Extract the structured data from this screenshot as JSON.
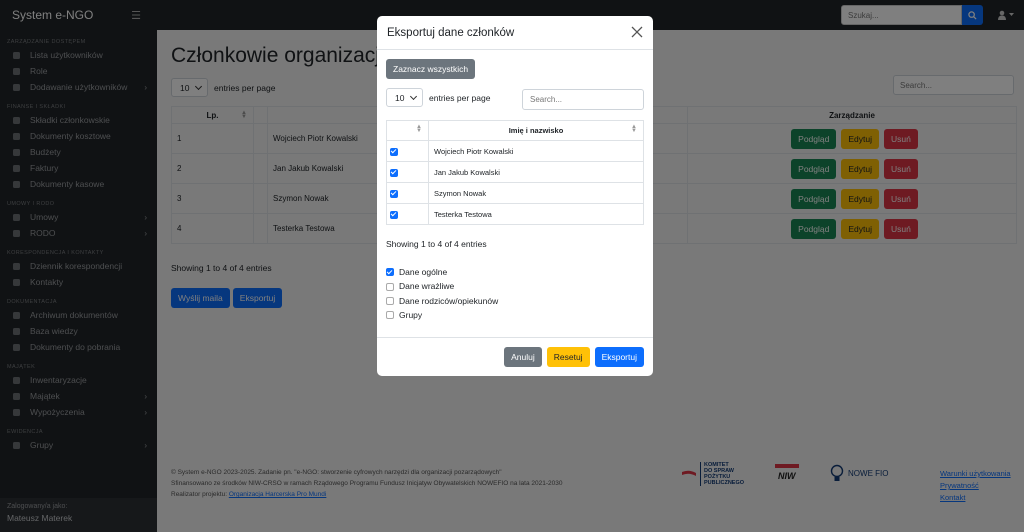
{
  "topbar": {
    "brand": "System e-NGO",
    "search_placeholder": "Szukaj..."
  },
  "sidebar": {
    "sections": [
      {
        "title": "ZARZĄDZANIE DOSTĘPEM",
        "items": [
          {
            "label": "Lista użytkowników",
            "icon": "users-icon",
            "arrow": false
          },
          {
            "label": "Role",
            "icon": "roles-icon",
            "arrow": false
          },
          {
            "label": "Dodawanie użytkowników",
            "icon": "user-plus-icon",
            "arrow": true
          }
        ]
      },
      {
        "title": "FINANSE I SKŁADKI",
        "items": [
          {
            "label": "Składki członkowskie",
            "icon": "dues-icon",
            "arrow": false
          },
          {
            "label": "Dokumenty kosztowe",
            "icon": "cost-documents-icon",
            "arrow": false
          },
          {
            "label": "Budżety",
            "icon": "budget-icon",
            "arrow": false
          },
          {
            "label": "Faktury",
            "icon": "invoice-icon",
            "arrow": false
          },
          {
            "label": "Dokumenty kasowe",
            "icon": "cash-documents-icon",
            "arrow": false
          }
        ]
      },
      {
        "title": "UMOWY I RODO",
        "items": [
          {
            "label": "Umowy",
            "icon": "contract-icon",
            "arrow": true
          },
          {
            "label": "RODO",
            "icon": "rodo-icon",
            "arrow": true
          }
        ]
      },
      {
        "title": "KORESPONDENCJA I KONTAKTY",
        "items": [
          {
            "label": "Dziennik korespondencji",
            "icon": "journal-icon",
            "arrow": false
          },
          {
            "label": "Kontakty",
            "icon": "contacts-icon",
            "arrow": false
          }
        ]
      },
      {
        "title": "DOKUMENTACJA",
        "items": [
          {
            "label": "Archiwum dokumentów",
            "icon": "archive-icon",
            "arrow": false
          },
          {
            "label": "Baza wiedzy",
            "icon": "knowledge-icon",
            "arrow": false
          },
          {
            "label": "Dokumenty do pobrania",
            "icon": "download-icon",
            "arrow": false
          }
        ]
      },
      {
        "title": "MAJĄTEK",
        "items": [
          {
            "label": "Inwentaryzacje",
            "icon": "inventory-icon",
            "arrow": false
          },
          {
            "label": "Majątek",
            "icon": "assets-icon",
            "arrow": true
          },
          {
            "label": "Wypożyczenia",
            "icon": "loans-icon",
            "arrow": true
          }
        ]
      },
      {
        "title": "EWIDENCJA",
        "items": [
          {
            "label": "Grupy",
            "icon": "groups-icon",
            "arrow": true
          }
        ]
      }
    ],
    "footer_label": "Zalogowany/a jako:",
    "footer_user": "Mateusz Materek"
  },
  "main": {
    "title": "Członkowie organizacji",
    "page_size": "10",
    "entries_label": "entries per page",
    "search_placeholder": "Search...",
    "col_lp": "Lp.",
    "col_manage": "Zarządzanie",
    "rows": [
      {
        "lp": "1",
        "name": "Wojciech Piotr Kowalski"
      },
      {
        "lp": "2",
        "name": "Jan Jakub Kowalski"
      },
      {
        "lp": "3",
        "name": "Szymon Nowak"
      },
      {
        "lp": "4",
        "name": "Testerka Testowa"
      }
    ],
    "btn_view": "Podgląd",
    "btn_edit": "Edytuj",
    "btn_delete": "Usuń",
    "showing": "Showing 1 to 4 of 4 entries",
    "send_mail": "Wyślij maila",
    "export": "Eksportuj"
  },
  "footer": {
    "line1": "© System e-NGO 2023-2025. Zadanie pn. \"e-NGO: stworzenie cyfrowych narzędzi dla organizacji pozarządowych\"",
    "line2": "Sfinansowano ze środków NIW-CRSO w ramach Rządowego Programu Fundusz Inicjatyw Obywatelskich NOWEFIO na lata 2021-2030",
    "line3_prefix": "Realizator projektu: ",
    "line3_link": "Organizacja Harcerska Pro Mundi",
    "logo1": [
      "KOMITET",
      "DO SPRAW",
      "POŻYTKU",
      "PUBLICZNEGO"
    ],
    "logo2": "NIW",
    "logo3": "NOWE FIO",
    "links": [
      "Warunki użytkowania",
      "Prywatność",
      "Kontakt"
    ]
  },
  "modal": {
    "title": "Eksportuj dane członków",
    "select_all": "Zaznacz wszystkich",
    "page_size": "10",
    "entries_label": "entries per page",
    "search_placeholder": "Search...",
    "col_name": "Imię i nazwisko",
    "rows": [
      {
        "name": "Wojciech Piotr Kowalski",
        "checked": true
      },
      {
        "name": "Jan Jakub Kowalski",
        "checked": true
      },
      {
        "name": "Szymon Nowak",
        "checked": true
      },
      {
        "name": "Testerka Testowa",
        "checked": true
      }
    ],
    "showing": "Showing 1 to 4 of 4 entries",
    "options": [
      {
        "label": "Dane ogólne",
        "checked": true
      },
      {
        "label": "Dane wrażliwe",
        "checked": false
      },
      {
        "label": "Dane rodziców/opiekunów",
        "checked": false
      },
      {
        "label": "Grupy",
        "checked": false
      }
    ],
    "cancel": "Anuluj",
    "reset": "Resetuj",
    "export": "Eksportuj"
  }
}
